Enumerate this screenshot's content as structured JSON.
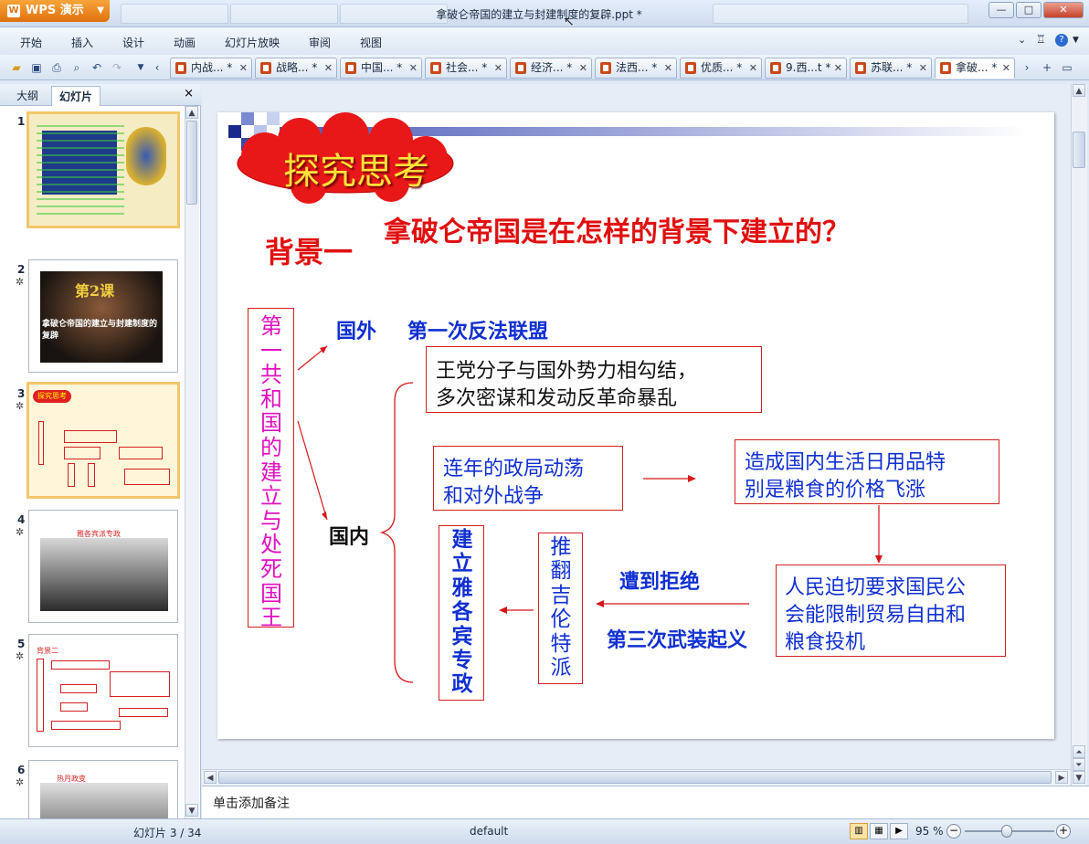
{
  "app": {
    "brand": "WPS 演示",
    "document_title": "拿破仑帝国的建立与封建制度的复辟.ppt *"
  },
  "menu": [
    "开始",
    "插入",
    "设计",
    "动画",
    "幻灯片放映",
    "审阅",
    "视图"
  ],
  "doc_tabs": [
    "内战... *",
    "战略... *",
    "中国... *",
    "社会... *",
    "经济... *",
    "法西... *",
    "优质... *",
    "9.西...t *",
    "苏联... *",
    "拿破... *"
  ],
  "panel": {
    "tab_outline": "大纲",
    "tab_slides": "幻灯片",
    "close": "×"
  },
  "thumbnails": [
    {
      "num": "1",
      "star": ""
    },
    {
      "num": "2",
      "star": "✲",
      "lesson": "第2课",
      "subtitle": "拿破仑帝国的建立与封建制度的复辟"
    },
    {
      "num": "3",
      "star": "✲",
      "title": "探究思考"
    },
    {
      "num": "4",
      "star": "✲",
      "title": "雅各宾派专政"
    },
    {
      "num": "5",
      "star": "✲",
      "title": "背景二"
    },
    {
      "num": "6",
      "star": "✲",
      "title": "热月政变"
    }
  ],
  "slide": {
    "banner": "探究思考",
    "bg_label": "背景一",
    "question": "拿破仑帝国是在怎样的背景下建立的？",
    "republic": "第一共和国的建立与处死国王",
    "abroad": "国外",
    "coalition": "第一次反法联盟",
    "domestic": "国内",
    "box1_line1": "王党分子与国外势力相勾结，",
    "box1_line2": "多次密谋和发动反革命暴乱",
    "box2_line1": "连年的政局动荡",
    "box2_line2": "和对外战争",
    "box3_line1": "造成国内生活日用品特",
    "box3_line2": "别是粮食的价格飞涨",
    "box4_line1": "人民迫切要求国民公",
    "box4_line2": "会能限制贸易自由和",
    "box4_line3": "粮食投机",
    "rejected": "遭到拒绝",
    "uprising": "第三次武装起义",
    "girondin": "推翻吉伦特派",
    "jacobin": "建立雅各宾专政"
  },
  "notes_placeholder": "单击添加备注",
  "status": {
    "slide_counter": "幻灯片 3 / 34",
    "theme": "default",
    "zoom": "95 %"
  },
  "colors": {
    "accent": "#e0720d",
    "title_red": "#e01010",
    "text_blue": "#1030d0",
    "republic_magenta": "#e010c0"
  }
}
